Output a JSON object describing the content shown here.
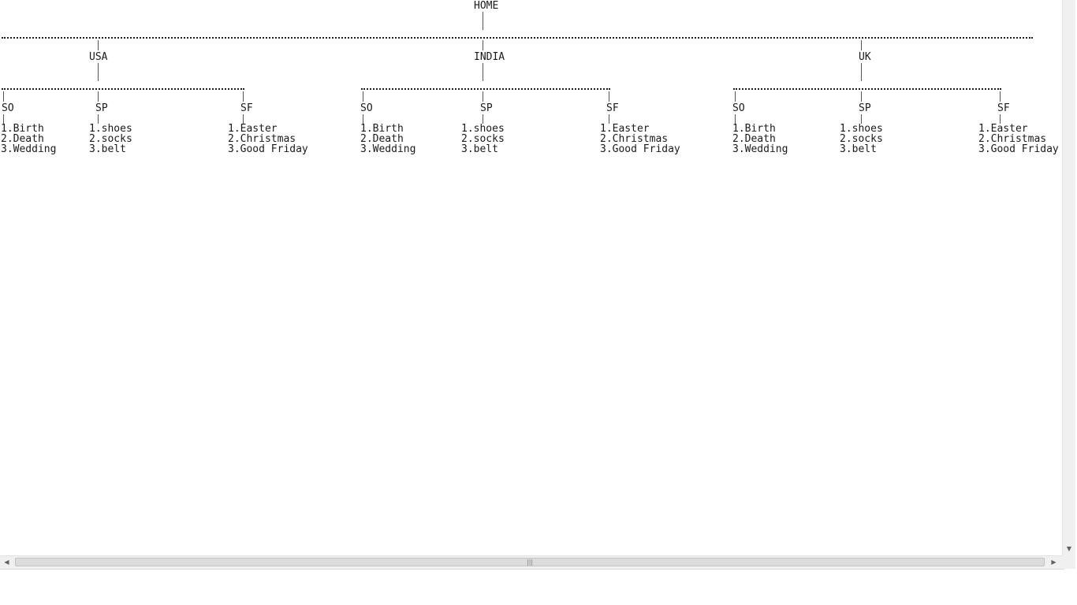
{
  "tree": {
    "root": "HOME",
    "countries": [
      {
        "name": "USA",
        "groups": [
          {
            "code": "SO",
            "items": [
              "1.Birth",
              "2.Death",
              "3.Wedding"
            ]
          },
          {
            "code": "SP",
            "items": [
              "1.shoes",
              "2.socks",
              "3.belt"
            ]
          },
          {
            "code": "SF",
            "items": [
              "1.Easter",
              "2.Christmas",
              "3.Good Friday"
            ]
          }
        ]
      },
      {
        "name": "INDIA",
        "groups": [
          {
            "code": "SO",
            "items": [
              "1.Birth",
              "2.Death",
              "3.Wedding"
            ]
          },
          {
            "code": "SP",
            "items": [
              "1.shoes",
              "2.socks",
              "3.belt"
            ]
          },
          {
            "code": "SF",
            "items": [
              "1.Easter",
              "2.Christmas",
              "3.Good Friday"
            ]
          }
        ]
      },
      {
        "name": "UK",
        "groups": [
          {
            "code": "SO",
            "items": [
              "1.Birth",
              "2.Death",
              "3.Wedding"
            ]
          },
          {
            "code": "SP",
            "items": [
              "1.shoes",
              "2.socks",
              "3.belt"
            ]
          },
          {
            "code": "SF",
            "items": [
              "1.Easter",
              "2.Christmas",
              "3.Good Friday"
            ]
          }
        ]
      }
    ]
  },
  "scrollbars": {
    "left_arrow": "left-arrow-icon",
    "right_arrow": "right-arrow-icon",
    "down_arrow": "down-arrow-icon",
    "grip": "grip-icon"
  }
}
